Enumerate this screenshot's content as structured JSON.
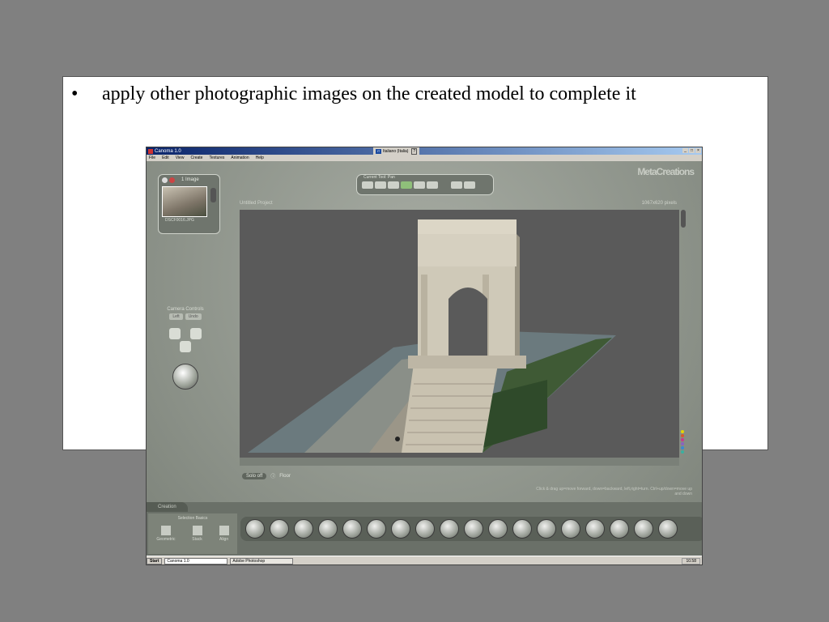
{
  "slide": {
    "bullet_symbol": "•",
    "bullet_text": "apply other photographic images on the created model to complete it"
  },
  "window": {
    "title": "Canoma 1.0",
    "language": "Italiano (Italia)",
    "help": "?",
    "controls": [
      "_",
      "□",
      "×"
    ]
  },
  "menu": [
    "File",
    "Edit",
    "View",
    "Create",
    "Textures",
    "Animation",
    "Help"
  ],
  "app": {
    "logo": "MetaCreations",
    "image_panel_title": "1 Image",
    "image_filename": "DSCF0016.JPG",
    "current_tool": "Current Tool: Pan",
    "project_title": "Untitled Project",
    "resolution": "1067x620 pixels",
    "camera_controls": "Camera Controls",
    "camera_buttons": [
      "Left",
      "Undo"
    ],
    "solo": "Solo off",
    "floor": "Floor",
    "hint": "Click & drag up=move forward, down=backward, left,right=turn. Ctrl+up/down=move up and down",
    "tab_creation": "Creation",
    "selection_basics": "Selection Basics",
    "selection_items": [
      "Geometric",
      "Stack",
      "Align"
    ],
    "color_dots": [
      "#e6d400",
      "#d85a2a",
      "#c93a8a",
      "#8a62c0",
      "#3a8ad0",
      "#3ab0a0"
    ]
  },
  "taskbar": {
    "start": "Start",
    "tasks": [
      "Canoma 1.0",
      "Adobe Photoshop"
    ],
    "clock": "10.58"
  }
}
